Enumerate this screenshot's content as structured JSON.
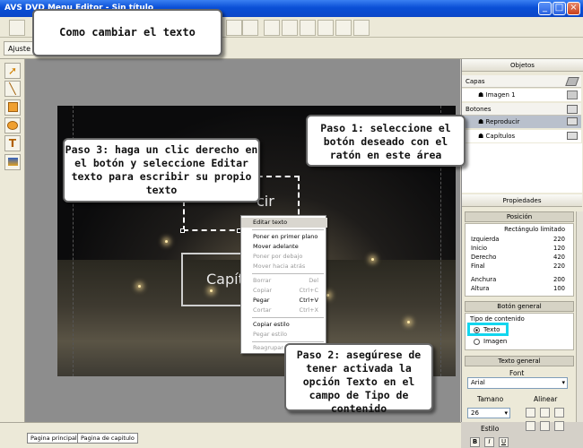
{
  "window": {
    "title": "AVS DVD Menu Editor - Sin título"
  },
  "toolbar": {
    "adjust_label": "Ajuste"
  },
  "callouts": {
    "title": "Como cambiar el texto",
    "step1": "Paso 1: seleccione el botón deseado con el ratón en este área",
    "step2": "Paso 2: asegúrese de tener activada la opción Texto en el campo de Tipo de contenido",
    "step3": "Paso 3: haga un clic  derecho en el botón y seleccione Editar texto para escribir su propio texto"
  },
  "canvas": {
    "button1_partial": "cir",
    "button2_partial": "Capít"
  },
  "context_menu": [
    {
      "label": "Editar texto",
      "shortcut": "",
      "enabled": true,
      "highlighted": true
    },
    {
      "label": "Poner en primer plano",
      "shortcut": "",
      "enabled": true
    },
    {
      "label": "Mover adelante",
      "shortcut": "",
      "enabled": true
    },
    {
      "label": "Poner por debajo",
      "shortcut": "",
      "enabled": false
    },
    {
      "label": "Mover hacia atrás",
      "shortcut": "",
      "enabled": false
    },
    {
      "label": "Borrar",
      "shortcut": "Del",
      "enabled": false
    },
    {
      "label": "Copiar",
      "shortcut": "Ctrl+C",
      "enabled": false
    },
    {
      "label": "Pegar",
      "shortcut": "Ctrl+V",
      "enabled": true
    },
    {
      "label": "Cortar",
      "shortcut": "Ctrl+X",
      "enabled": false
    },
    {
      "label": "Copiar estilo",
      "shortcut": "",
      "enabled": true
    },
    {
      "label": "Pegar estilo",
      "shortcut": "",
      "enabled": false
    },
    {
      "label": "Reagrupar",
      "shortcut": "",
      "enabled": false
    }
  ],
  "objects_panel": {
    "header": "Objetos",
    "layers_label": "Capas",
    "layer_item": "Imagen 1",
    "buttons_label": "Botones",
    "button_items": [
      "Reproducir",
      "Capítulos"
    ],
    "selected_button": "Reproducir"
  },
  "properties_panel": {
    "header": "Propiedades",
    "position_section": "Posición",
    "bounding_label": "Rectángulo limitado",
    "rows": [
      {
        "label": "Izquierda",
        "value": "220"
      },
      {
        "label": "Inicio",
        "value": "120"
      },
      {
        "label": "Derecho",
        "value": "420"
      },
      {
        "label": "Final",
        "value": "220"
      },
      {
        "label": "Anchura",
        "value": "200"
      },
      {
        "label": "Altura",
        "value": "100"
      }
    ],
    "general_button_section": "Botón general",
    "content_type_label": "Tipo de contenido",
    "content_options": [
      "Texto",
      "Imagen"
    ],
    "selected_content": "Texto",
    "general_text_section": "Texto general",
    "font_label": "Font",
    "font_value": "Arial",
    "size_label": "Tamano",
    "size_value": "26",
    "align_label": "Alinear",
    "style_label": "Estilo"
  },
  "page_tabs": [
    "Pagina principal",
    "Pagina de capitulo"
  ],
  "colors": {
    "titlebar": "#0a4fd6",
    "callout_border": "#666666",
    "highlight": "#13d6ee"
  }
}
